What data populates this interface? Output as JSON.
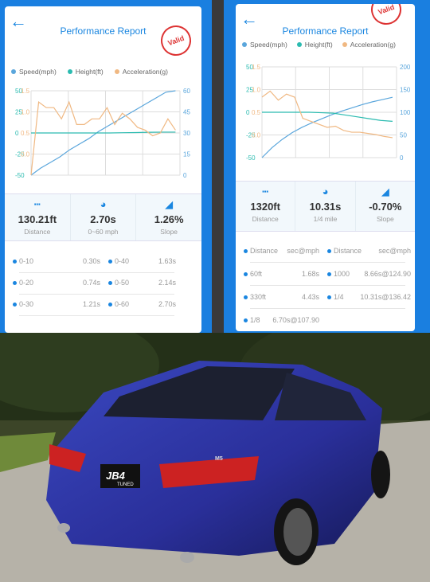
{
  "left": {
    "title": "Performance Report",
    "stamp": "Valid",
    "legend": [
      "Speed(mph)",
      "Height(ft)",
      "Acceleration(g)"
    ],
    "stats": [
      {
        "icon": "ruler-icon",
        "value": "130.21ft",
        "label": "Distance"
      },
      {
        "icon": "speedometer-icon",
        "value": "2.70s",
        "label": "0~60 mph"
      },
      {
        "icon": "slope-icon",
        "value": "1.26%",
        "label": "Slope"
      }
    ],
    "splits": [
      [
        "0-10",
        "0.30s",
        "0-40",
        "1.63s"
      ],
      [
        "0-20",
        "0.74s",
        "0-50",
        "2.14s"
      ],
      [
        "0-30",
        "1.21s",
        "0-60",
        "2.70s"
      ]
    ]
  },
  "right": {
    "title": "Performance Report",
    "stamp": "Valid",
    "legend": [
      "Speed(mph)",
      "Height(ft)",
      "Acceleration(g)"
    ],
    "stats": [
      {
        "icon": "ruler-icon",
        "value": "1320ft",
        "label": "Distance"
      },
      {
        "icon": "speedometer-icon",
        "value": "10.31s",
        "label": "1/4 mile"
      },
      {
        "icon": "slope-icon",
        "value": "-0.70%",
        "label": "Slope"
      }
    ],
    "header": [
      "Distance",
      "sec@mph",
      "Distance",
      "sec@mph"
    ],
    "splits": [
      [
        "60ft",
        "1.68s",
        "1000",
        "8.66s@124.90"
      ],
      [
        "330ft",
        "4.43s",
        "1/4",
        "10.31s@136.42"
      ],
      [
        "1/8",
        "6.70s@107.90"
      ]
    ]
  },
  "photo": {
    "plate": "JB4",
    "plate_sub": "TUNED",
    "badge": "M5"
  },
  "colors": {
    "speed": "#5aa6dc",
    "height": "#2bbbb0",
    "accel": "#f0b882",
    "accent": "#1a86e0"
  },
  "chart_data": [
    {
      "type": "line",
      "series": [
        {
          "name": "Speed(mph)",
          "axis": "right",
          "values": [
            0,
            5,
            9,
            13,
            18,
            22,
            26,
            31,
            35,
            39,
            43,
            47,
            51,
            55,
            59,
            60
          ]
        },
        {
          "name": "Height(ft)",
          "axis": "left",
          "values": [
            0,
            0,
            0,
            0,
            0,
            0,
            0,
            0.3,
            0.5,
            0.8,
            1,
            1
          ]
        },
        {
          "name": "Acceleration(g)",
          "axis": "left2",
          "values": [
            0,
            1.3,
            1.2,
            1.2,
            1.0,
            1.3,
            0.9,
            0.9,
            1.0,
            1.0,
            1.2,
            0.9,
            1.1,
            1.0,
            0.85,
            0.8,
            0.7,
            0.75,
            1.0,
            0.8
          ]
        }
      ],
      "yleft": {
        "range": [
          -50,
          50
        ],
        "ticks": [
          "50",
          "25",
          "0",
          "-25",
          "-50"
        ]
      },
      "yleft2": {
        "range": [
          0,
          1.5
        ],
        "ticks": [
          "1.5",
          "1.0",
          "0.5",
          "0.0"
        ]
      },
      "yright": {
        "range": [
          0,
          60
        ],
        "ticks": [
          "60",
          "45",
          "30",
          "15",
          "0"
        ]
      },
      "grid": true,
      "legend": "top"
    },
    {
      "type": "line",
      "series": [
        {
          "name": "Speed(mph)",
          "axis": "right",
          "values": [
            0,
            22,
            40,
            55,
            67,
            77,
            86,
            95,
            103,
            110,
            117,
            123,
            128,
            133
          ]
        },
        {
          "name": "Height(ft)",
          "axis": "left",
          "values": [
            0,
            0,
            0,
            0,
            0,
            -0.5,
            -1,
            -3,
            -5,
            -7,
            -9,
            -10
          ]
        },
        {
          "name": "Acceleration(g)",
          "axis": "left2",
          "values": [
            1.0,
            1.1,
            0.95,
            1.05,
            1.0,
            0.65,
            0.6,
            0.55,
            0.5,
            0.52,
            0.45,
            0.42,
            0.42,
            0.4,
            0.38,
            0.35,
            0.33
          ]
        }
      ],
      "yleft": {
        "range": [
          -50,
          50
        ],
        "ticks": [
          "50",
          "25",
          "0",
          "-25",
          "-50"
        ]
      },
      "yleft2": {
        "range": [
          0,
          1.5
        ],
        "ticks": [
          "1.5",
          "1.0",
          "0.5",
          "0.0"
        ]
      },
      "yright": {
        "range": [
          0,
          200
        ],
        "ticks": [
          "200",
          "150",
          "100",
          "50",
          "0"
        ]
      },
      "grid": true,
      "legend": "top"
    }
  ]
}
